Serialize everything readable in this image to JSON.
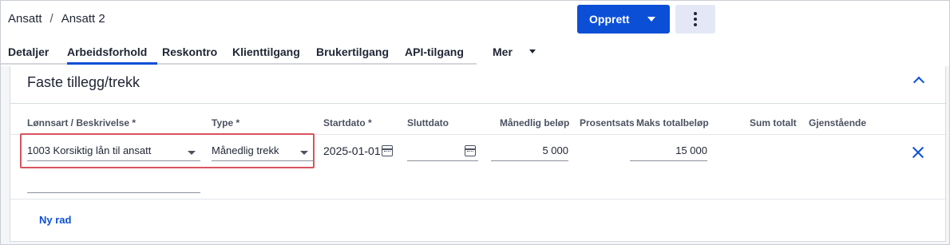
{
  "breadcrumb": {
    "items": [
      "Ansatt",
      "Ansatt 2"
    ],
    "separator": "/"
  },
  "header": {
    "create_label": "Opprett",
    "create_icon": "chevron-down-icon",
    "more_icon": "more-vertical-icon"
  },
  "tabs": [
    {
      "label": "Detaljer",
      "active": false
    },
    {
      "label": "Arbeidsforhold",
      "active": true
    },
    {
      "label": "Reskontro",
      "active": false
    },
    {
      "label": "Klienttilgang",
      "active": false
    },
    {
      "label": "Brukertilgang",
      "active": false
    },
    {
      "label": "API-tilgang",
      "active": false
    },
    {
      "label": "Mer",
      "active": false
    }
  ],
  "section": {
    "title": "Faste tillegg/trekk",
    "collapse_icon": "chevron-up-icon"
  },
  "table": {
    "columns": [
      "Lønnsart / Beskrivelse *",
      "Type *",
      "Startdato *",
      "Sluttdato",
      "Månedlig beløp",
      "Prosentsats",
      "Maks totalbeløp",
      "Sum totalt",
      "Gjenstående"
    ],
    "row": {
      "lonnsart": "1003 Korsiktig lån til ansatt",
      "type": "Månedlig trekk",
      "startdato": "2025-01-01",
      "sluttdato": "",
      "manedlig_belop": "5 000",
      "prosentsats": "",
      "maks_totalbelop": "15 000",
      "sum_totalt": "",
      "gjenstaende": ""
    },
    "description": "",
    "add_row_label": "Ny rad"
  },
  "colors": {
    "accent": "#0b4fd6",
    "highlight": "#d9535d",
    "text": "#1f2533"
  }
}
